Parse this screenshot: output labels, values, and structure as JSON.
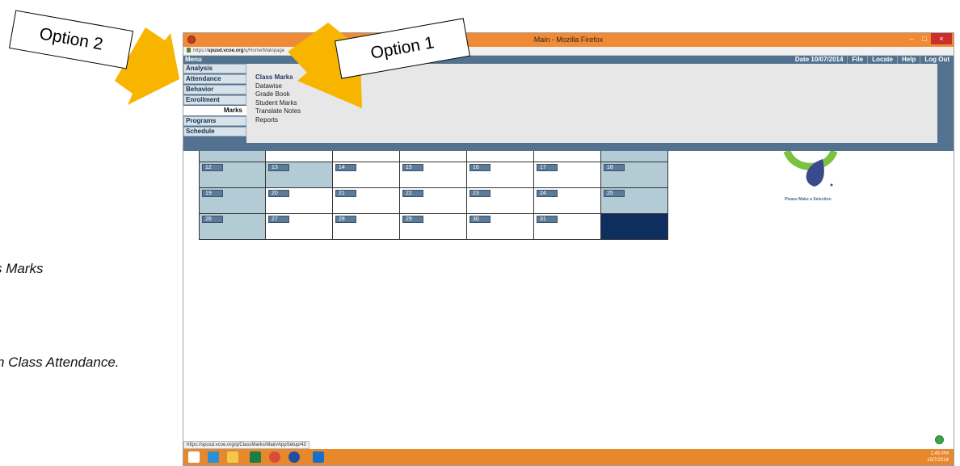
{
  "document": {
    "line1": "s Marks",
    "line2": "n Class Attendance."
  },
  "callouts": {
    "option1": "Option 1",
    "option2": "Option 2"
  },
  "window": {
    "title": "Main - Mozilla Firefox",
    "url_prefix": "https://",
    "url_domain": "spusd.vcoe.org",
    "url_path": "/q/Home/Mainpage",
    "close_glyph": "×",
    "minimize_glyph": "–",
    "maximize_glyph": "□"
  },
  "app": {
    "menu_label": "Menu",
    "date_label": "Date  10/07/2014",
    "nav": [
      "File",
      "Locate",
      "Help",
      "Log Out"
    ],
    "sidebar": [
      "Analysis",
      "Attendance",
      "Behavior",
      "Enrollment",
      "Marks",
      "Programs",
      "Schedule"
    ],
    "active_item": "Marks",
    "submenu": [
      "Class Marks",
      "Datawise",
      "Grade Book",
      "Student Marks",
      "Translate Notes",
      "Reports"
    ],
    "logo_caption": "Please Make a Selection"
  },
  "calendar": {
    "rows": [
      [
        "12",
        "13",
        "14",
        "15",
        "16",
        "17",
        "18"
      ],
      [
        "19",
        "20",
        "21",
        "22",
        "23",
        "24",
        "25"
      ],
      [
        "26",
        "27",
        "28",
        "29",
        "30",
        "31",
        ""
      ]
    ]
  },
  "status": {
    "url": "https://spusd.vcoe.org/q/ClassMarks/Main/AppSetup/43",
    "clock_time": "1:45 PM",
    "clock_date": "10/7/2014"
  },
  "colors": {
    "header_blue": "#52728f",
    "callout_arrow": "#f7b500",
    "titlebar": "#f08a34"
  }
}
